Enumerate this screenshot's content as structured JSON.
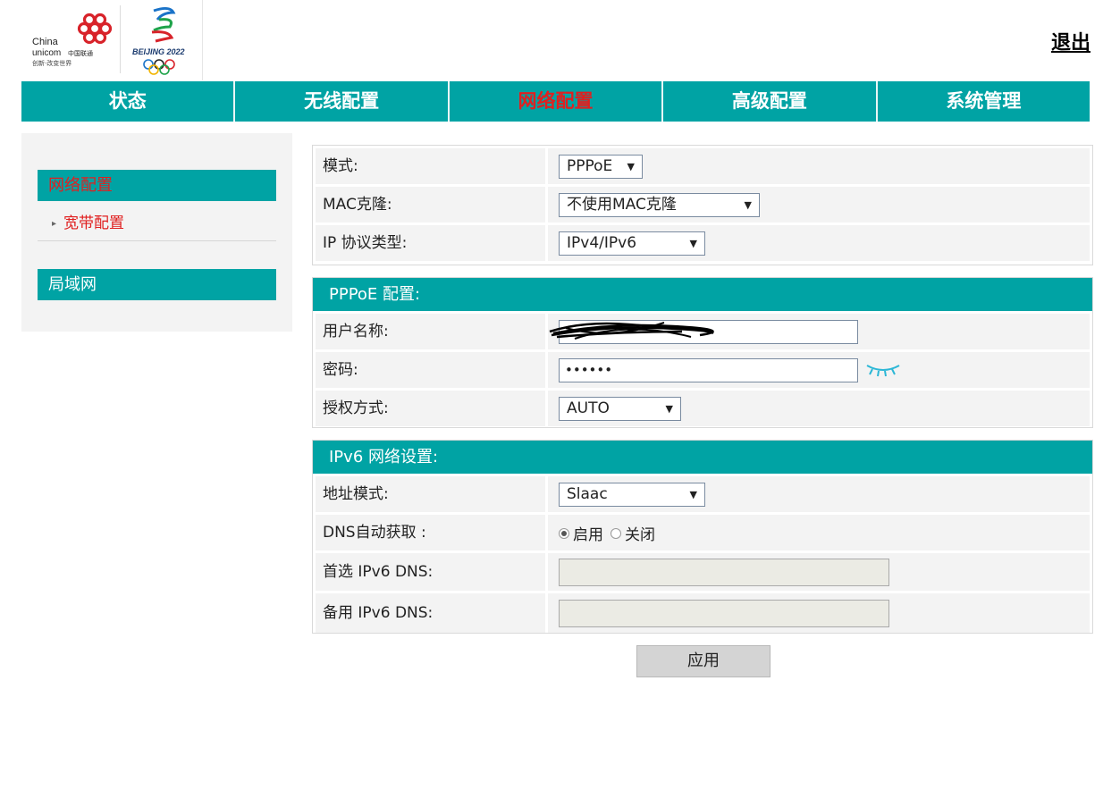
{
  "header": {
    "brand_cu_en1": "China",
    "brand_cu_en2": "unicom",
    "brand_cu_zh": "中国联通",
    "brand_cu_slogan": "创新·改变世界",
    "brand_bj": "BEIJING 2022",
    "logout": "退出"
  },
  "topnav": {
    "tabs": [
      {
        "label": "状态"
      },
      {
        "label": "无线配置"
      },
      {
        "label": "网络配置",
        "active": true
      },
      {
        "label": "高级配置"
      },
      {
        "label": "系统管理"
      }
    ]
  },
  "sidebar": {
    "group1": "网络配置",
    "group1_sub": "宽带配置",
    "group2": "局域网"
  },
  "basic": {
    "mode_label": "模式:",
    "mode_value": "PPPoE",
    "mac_label": "MAC克隆:",
    "mac_value": "不使用MAC克隆",
    "ip_label": "IP 协议类型:",
    "ip_value": "IPv4/IPv6"
  },
  "pppoe": {
    "title": "PPPoE 配置:",
    "user_label": "用户名称:",
    "pass_label": "密码:",
    "pass_value": "••••••",
    "auth_label": "授权方式:",
    "auth_value": "AUTO"
  },
  "ipv6": {
    "title": "IPv6 网络设置:",
    "addr_label": "地址模式:",
    "addr_value": "Slaac",
    "dns_auto_label": "DNS自动获取 :",
    "dns_on": "启用",
    "dns_off": "关闭",
    "dns1_label": "首选 IPv6 DNS:",
    "dns2_label": "备用 IPv6 DNS:"
  },
  "apply_label": "应用",
  "colors": {
    "teal": "#00a3a4",
    "active_red": "#e02020"
  }
}
